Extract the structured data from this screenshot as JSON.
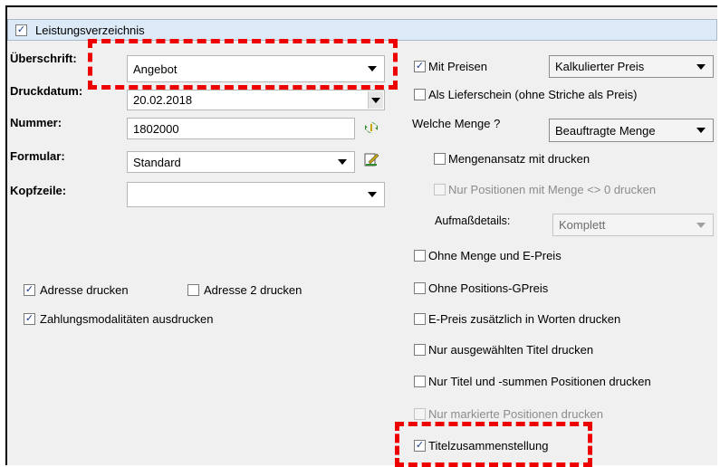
{
  "group": {
    "title": "Leistungsverzeichnis",
    "checked": true
  },
  "left": {
    "ueberschrift": {
      "label": "Überschrift:",
      "value": "Angebot"
    },
    "druckdatum": {
      "label": "Druckdatum:",
      "value": "20.02.2018"
    },
    "nummer": {
      "label": "Nummer:",
      "value": "1802000"
    },
    "formular": {
      "label": "Formular:",
      "value": "Standard"
    },
    "kopfzeile": {
      "label": "Kopfzeile:",
      "value": ""
    },
    "adresse": {
      "label": "Adresse drucken",
      "checked": true
    },
    "adresse2": {
      "label": "Adresse 2 drucken",
      "checked": false
    },
    "zahlung": {
      "label": "Zahlungsmodalitäten ausdrucken",
      "checked": true
    }
  },
  "right": {
    "mit_preisen": {
      "label": "Mit Preisen",
      "checked": true
    },
    "preis_select": {
      "value": "Kalkulierter Preis"
    },
    "lieferschein": {
      "label": "Als Lieferschein (ohne Striche als Preis)",
      "checked": false
    },
    "welche_menge": {
      "label": "Welche Menge ?",
      "value": "Beauftragte Menge"
    },
    "mengenansatz": {
      "label": "Mengenansatz mit drucken",
      "checked": false
    },
    "nur_positionen": {
      "label": "Nur Positionen mit Menge <> 0 drucken",
      "checked": false,
      "disabled": true
    },
    "aufmass": {
      "label": "Aufmaßdetails:",
      "value": "Komplett"
    },
    "ohne_menge": {
      "label": "Ohne Menge und E-Preis",
      "checked": false
    },
    "ohne_gpreis": {
      "label": "Ohne Positions-GPreis",
      "checked": false
    },
    "epreis_worte": {
      "label": "E-Preis zusätzlich in Worten drucken",
      "checked": false
    },
    "nur_titel": {
      "label": "Nur ausgewählten Titel drucken",
      "checked": false
    },
    "nur_titel_summen": {
      "label": "Nur Titel und -summen Positionen drucken",
      "checked": false
    },
    "nur_markierte": {
      "label": "Nur markierte Positionen drucken",
      "checked": false,
      "disabled": true
    },
    "titelzusammenstellung": {
      "label": "Titelzusammenstellung",
      "checked": true
    }
  },
  "glyphs": {
    "check": "✓"
  },
  "colors": {
    "highlight": "#ee0000",
    "header_bg": "#dce9f7",
    "panel_bg": "#f0f0f0"
  }
}
